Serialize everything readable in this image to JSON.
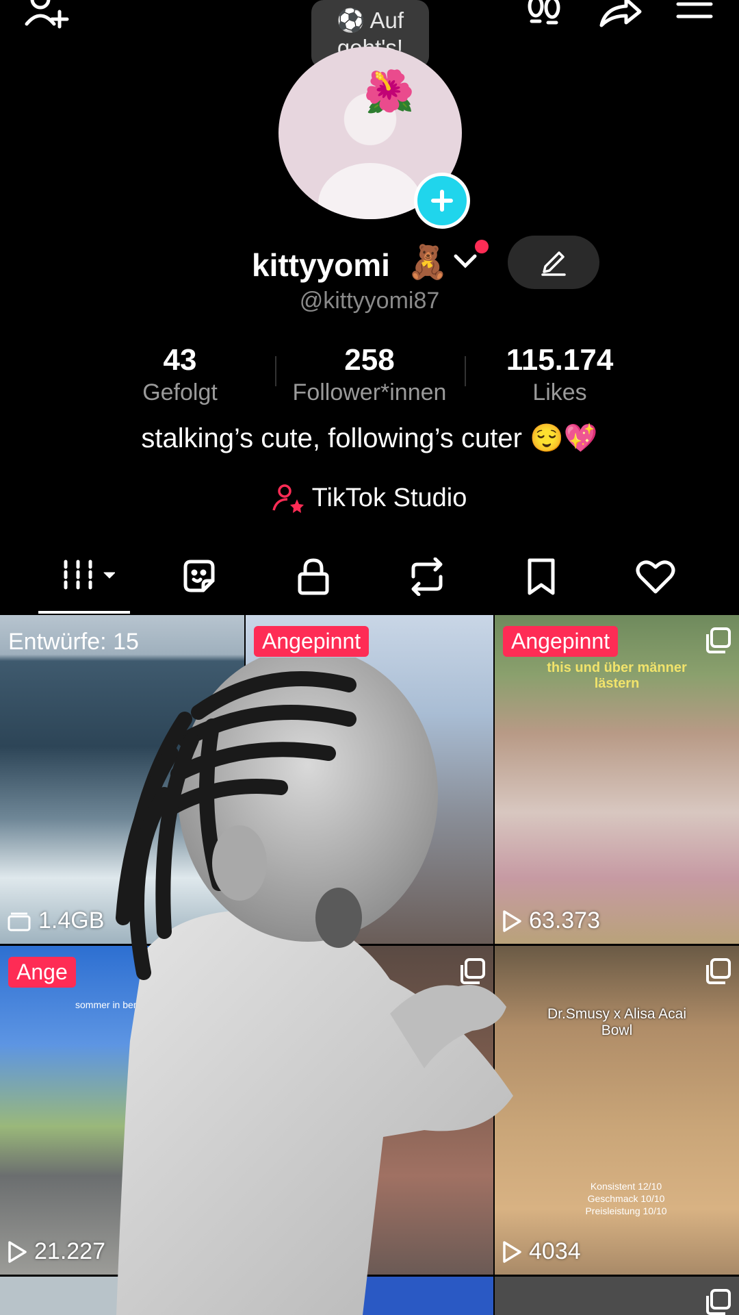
{
  "top_bar": {
    "tooltip_emoji": "⚽",
    "tooltip_line1": "Auf",
    "tooltip_line2": "geht's!"
  },
  "profile": {
    "avatar_emoji": "🌺",
    "display_name": "kittyyomi",
    "name_emoji": "🧸",
    "handle": "@kittyyomi87",
    "bio": "stalking’s cute, following’s cuter 😌💖",
    "studio_label": "TikTok Studio"
  },
  "stats": [
    {
      "value": "43",
      "label": "Gefolgt"
    },
    {
      "value": "258",
      "label": "Follower*innen"
    },
    {
      "value": "115.174",
      "label": "Likes"
    }
  ],
  "tabs": [
    "videos",
    "favorites",
    "private",
    "reposts",
    "saved",
    "liked"
  ],
  "grid": {
    "drafts_label": "Entwürfe: 15",
    "drafts_size": "1.4GB",
    "pinned_label": "Angepinnt",
    "pinned_partial": "Ange",
    "tile3_caption_line1": "this und über männer",
    "tile3_caption_line2": "lästern",
    "tile3_views": "63.373",
    "tile4_caption": "sommer in berlin >>",
    "tile4_views": "21.227",
    "tile6_title_line1": "Dr.Smusy x Alisa Acai",
    "tile6_title_line2": "Bowl",
    "tile6_rating1": "Konsistent 12/10",
    "tile6_rating2": "Geschmack 10/10",
    "tile6_rating3": "Preisleistung 10/10",
    "tile6_views": "4034"
  },
  "colors": {
    "accent": "#fe2c55",
    "teal": "#20d5ec",
    "background": "#000000"
  }
}
